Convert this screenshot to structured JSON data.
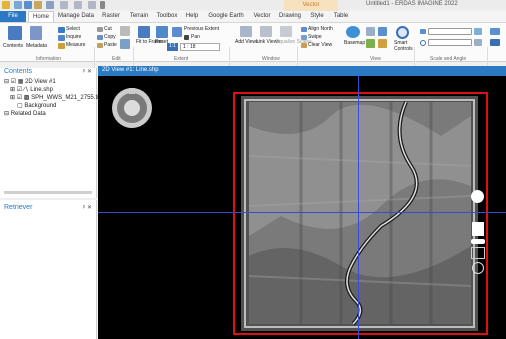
{
  "app_title": "Untitled1 - ERDAS IMAGINE 2022",
  "contextual_tab": "Vector",
  "tabs": [
    "File",
    "Home",
    "Manage Data",
    "Raster",
    "Terrain",
    "Toolbox",
    "Help",
    "Google Earth",
    "Vector",
    "Drawing",
    "Style",
    "Table"
  ],
  "ribbon": {
    "contents": "Contents",
    "metadata": "Metadata",
    "select": "Select",
    "inquire": "Inquire",
    "measure": "Measure",
    "information_group": "Information",
    "cut": "Cut",
    "copy": "Copy",
    "paste": "Paste",
    "edit_group": "Edit",
    "fit_to_frame": "Fit to Frame",
    "reset": "Reset",
    "zoom_ratio": "1:1",
    "scale_value": "1 : 18",
    "previous_extent": "Previous Extent",
    "pan": "Pan",
    "extent_group": "Extent",
    "add_views": "Add Views",
    "link_views": "Link Views",
    "equalize_scales": "Equalize Scales",
    "window_group": "Window",
    "align_north": "Align North",
    "swipe": "Swipe",
    "clear_view": "Clear View",
    "basemap": "Basemap",
    "smart_controls": "Smart Controls",
    "view_group": "View",
    "scale_angle_group": "Scale and Angle"
  },
  "contents_panel": {
    "title": "Contents",
    "items": [
      "2D View #1",
      "Line.shp",
      "SPH_WWS_M21_2755.tif",
      "Background",
      "Related Data"
    ]
  },
  "retriever_panel": {
    "title": "Retriever"
  },
  "view": {
    "title": "2D View #1: Line.shp"
  },
  "colors": {
    "accent": "#2b79c2",
    "selection": "#e01010",
    "crosshair": "#3a4bd6",
    "contextual": "#d07a1a"
  }
}
